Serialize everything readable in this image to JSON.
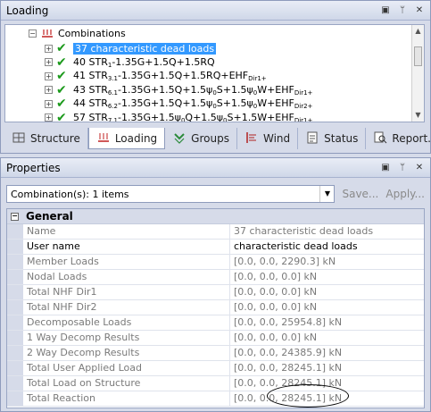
{
  "loading_panel": {
    "title": "Loading",
    "tree": {
      "root_label": "Combinations",
      "items": [
        {
          "label": "37 characteristic dead loads",
          "selected": true
        },
        {
          "label_html": "40 STR<sub>1</sub>-1.35G+1.5Q+1.5RQ"
        },
        {
          "label_html": "41 STR<sub>3.1</sub>-1.35G+1.5Q+1.5RQ+EHF<sub>Dir1+</sub>"
        },
        {
          "label_html": "43 STR<sub>6.1</sub>-1.35G+1.5Q+1.5ψ<sub>0</sub>S+1.5ψ<sub>0</sub>W+EHF<sub>Dir1+</sub>"
        },
        {
          "label_html": "44 STR<sub>6.2</sub>-1.35G+1.5Q+1.5ψ<sub>0</sub>S+1.5ψ<sub>0</sub>W+EHF<sub>Dir2+</sub>"
        },
        {
          "label_html": "57 STR<sub>7.1</sub>-1.35G+1.5ψ<sub>0</sub>Q+1.5ψ<sub>0</sub>S+1.5W+EHF<sub>Dir1+</sub>"
        }
      ]
    },
    "tabs": [
      {
        "label": "Structure",
        "icon": "structure-icon"
      },
      {
        "label": "Loading",
        "icon": "loading-icon",
        "active": true
      },
      {
        "label": "Groups",
        "icon": "groups-icon"
      },
      {
        "label": "Wind",
        "icon": "wind-icon"
      },
      {
        "label": "Status",
        "icon": "status-icon"
      },
      {
        "label": "Report...",
        "icon": "report-icon"
      }
    ]
  },
  "properties_panel": {
    "title": "Properties",
    "selector_value": "Combination(s): 1 items",
    "save_label": "Save...",
    "apply_label": "Apply...",
    "category": "General",
    "rows": [
      {
        "name": "Name",
        "value": "37 characteristic dead loads",
        "editable": false
      },
      {
        "name": "User name",
        "value": "characteristic dead loads",
        "editable": true
      },
      {
        "name": "Member Loads",
        "value": "[0.0, 0.0, 2290.3] kN",
        "editable": false
      },
      {
        "name": "Nodal Loads",
        "value": "[0.0, 0.0, 0.0] kN",
        "editable": false
      },
      {
        "name": "Total NHF Dir1",
        "value": "[0.0, 0.0, 0.0] kN",
        "editable": false
      },
      {
        "name": "Total NHF Dir2",
        "value": "[0.0, 0.0, 0.0] kN",
        "editable": false
      },
      {
        "name": "Decomposable Loads",
        "value": "[0.0, 0.0, 25954.8] kN",
        "editable": false
      },
      {
        "name": "1 Way Decomp Results",
        "value": "[0.0, 0.0, 0.0] kN",
        "editable": false
      },
      {
        "name": "2 Way Decomp Results",
        "value": "[0.0, 0.0, 24385.9] kN",
        "editable": false
      },
      {
        "name": "Total User Applied Load",
        "value": "[0.0, 0.0, 28245.1] kN",
        "editable": false
      },
      {
        "name": "Total Load on Structure",
        "value": "[0.0, 0.0, 28245.1] kN",
        "editable": false
      },
      {
        "name": "Total Reaction",
        "value": "[0.0, 0.0, 28245.1] kN",
        "editable": false
      }
    ]
  },
  "colors": {
    "selection": "#3399ff",
    "check": "#1c9a1c",
    "panel_bg": "#d6dbe9"
  }
}
